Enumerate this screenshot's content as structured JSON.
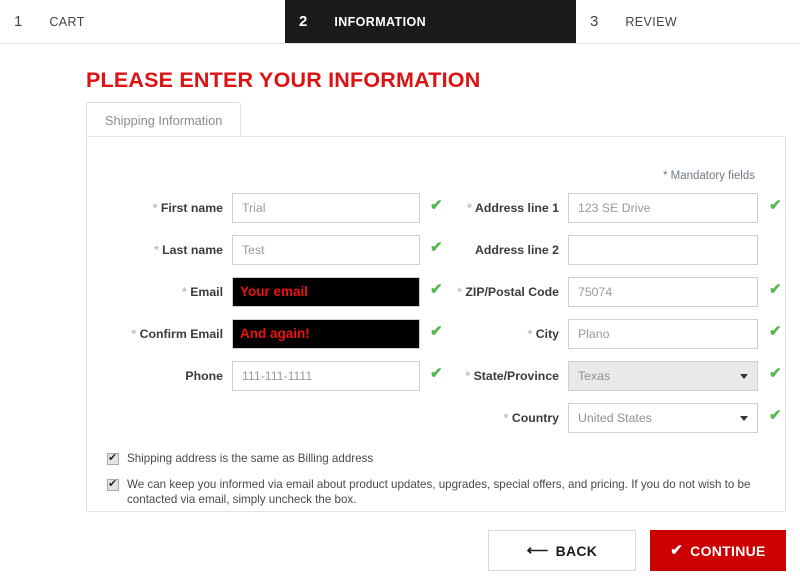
{
  "stepper": {
    "steps": [
      {
        "num": "1",
        "label": "CART",
        "active": false
      },
      {
        "num": "2",
        "label": "INFORMATION",
        "active": true
      },
      {
        "num": "3",
        "label": "REVIEW",
        "active": false
      }
    ]
  },
  "page": {
    "title": "PLEASE ENTER YOUR INFORMATION",
    "tab_label": "Shipping Information",
    "mandatory_note": "* Mandatory fields"
  },
  "form": {
    "left": [
      {
        "label": "First name",
        "star": "*",
        "value": "Trial",
        "type": "text",
        "valid": true
      },
      {
        "label": "Last name",
        "star": "*",
        "value": "Test",
        "type": "text",
        "valid": true
      },
      {
        "label": "Email",
        "star": "*",
        "value": "Your email",
        "type": "redacted",
        "valid": true
      },
      {
        "label": "Confirm Email",
        "star": "*",
        "value": "And again!",
        "type": "redacted",
        "valid": true
      },
      {
        "label": "Phone",
        "star": "",
        "value": "111-111-1111",
        "type": "text",
        "valid": true
      }
    ],
    "right": [
      {
        "label": "Address line 1",
        "star": "*",
        "value": "123 SE Drive",
        "type": "text",
        "valid": true
      },
      {
        "label": "Address line 2",
        "star": "",
        "value": "",
        "type": "text",
        "valid": false
      },
      {
        "label": "ZIP/Postal Code",
        "star": "*",
        "value": "75074",
        "type": "text",
        "valid": true
      },
      {
        "label": "City",
        "star": "*",
        "value": "Plano",
        "type": "text",
        "valid": true
      },
      {
        "label": "State/Province",
        "star": "*",
        "value": "Texas",
        "type": "select-filled",
        "valid": true
      },
      {
        "label": "Country",
        "star": "*",
        "value": "United States",
        "type": "select",
        "valid": true
      }
    ]
  },
  "checkboxes": [
    {
      "checked": true,
      "text": "Shipping address is the same as Billing address"
    },
    {
      "checked": true,
      "text": "We can keep you informed via email about product updates, upgrades, special offers, and pricing. If you do not wish to be contacted via email, simply uncheck the box."
    }
  ],
  "footer": {
    "back_label": "BACK",
    "back_icon": "arrow-left-icon",
    "continue_label": "CONTINUE",
    "continue_icon": "check-icon"
  },
  "colors": {
    "title_red": "#dd1212",
    "continue_red": "#cc0000",
    "active_step_bg": "#1b1b1b",
    "valid_green": "#55b84c",
    "redacted_bg": "#000000",
    "redacted_text": "#ee1111"
  }
}
